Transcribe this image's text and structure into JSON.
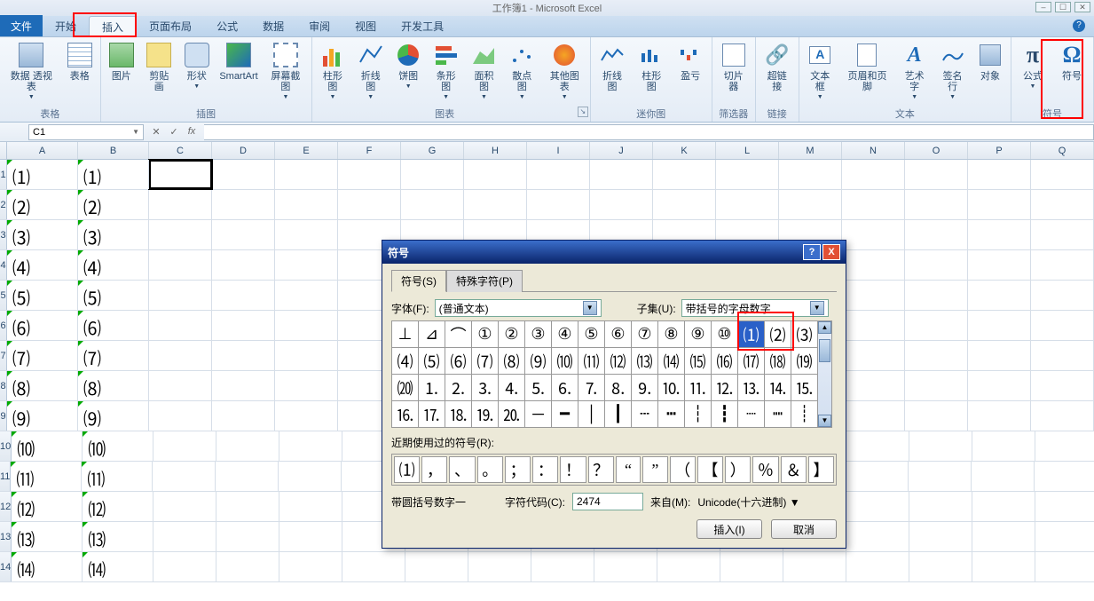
{
  "title": "工作簿1 - Microsoft Excel",
  "tabs": {
    "file": "文件",
    "list": [
      "开始",
      "插入",
      "页面布局",
      "公式",
      "数据",
      "审阅",
      "视图",
      "开发工具"
    ],
    "active_index": 1
  },
  "ribbon": {
    "groups": [
      {
        "label": "表格",
        "buttons": [
          {
            "name": "pivot",
            "label": "数据\n透视表",
            "icon": "pivot",
            "drop": true
          },
          {
            "name": "table",
            "label": "表格",
            "icon": "table"
          }
        ]
      },
      {
        "label": "插图",
        "buttons": [
          {
            "name": "picture",
            "label": "图片",
            "icon": "pic"
          },
          {
            "name": "clipart",
            "label": "剪贴画",
            "icon": "clip"
          },
          {
            "name": "shapes",
            "label": "形状",
            "icon": "shape",
            "drop": true
          },
          {
            "name": "smartart",
            "label": "SmartArt",
            "icon": "smart"
          },
          {
            "name": "screenshot",
            "label": "屏幕截图",
            "icon": "shot",
            "drop": true
          }
        ]
      },
      {
        "label": "图表",
        "launcher": true,
        "buttons": [
          {
            "name": "column-chart",
            "label": "柱形图",
            "icon": "bar",
            "drop": true
          },
          {
            "name": "line-chart",
            "label": "折线图",
            "icon": "line",
            "drop": true
          },
          {
            "name": "pie-chart",
            "label": "饼图",
            "icon": "pie",
            "drop": true
          },
          {
            "name": "bar-chart",
            "label": "条形图",
            "icon": "hbar",
            "drop": true
          },
          {
            "name": "area-chart",
            "label": "面积图",
            "icon": "area",
            "drop": true
          },
          {
            "name": "scatter-chart",
            "label": "散点图",
            "icon": "scatter",
            "drop": true
          },
          {
            "name": "other-chart",
            "label": "其他图表",
            "icon": "other",
            "drop": true
          }
        ]
      },
      {
        "label": "迷你图",
        "buttons": [
          {
            "name": "sparkline",
            "label": "折线图",
            "icon": "sline"
          },
          {
            "name": "sparkcol",
            "label": "柱形图",
            "icon": "scol"
          },
          {
            "name": "sparkwl",
            "label": "盈亏",
            "icon": "swl"
          }
        ]
      },
      {
        "label": "筛选器",
        "buttons": [
          {
            "name": "slicer",
            "label": "切片器",
            "icon": "slicer"
          }
        ]
      },
      {
        "label": "链接",
        "buttons": [
          {
            "name": "hyperlink",
            "label": "超链接",
            "icon": "link"
          }
        ]
      },
      {
        "label": "文本",
        "buttons": [
          {
            "name": "textbox",
            "label": "文本框",
            "icon": "tbox",
            "drop": true
          },
          {
            "name": "headerfooter",
            "label": "页眉和页脚",
            "icon": "hf"
          },
          {
            "name": "wordart",
            "label": "艺术字",
            "icon": "wa",
            "drop": true
          },
          {
            "name": "sigline",
            "label": "签名行",
            "icon": "sig",
            "drop": true
          },
          {
            "name": "object",
            "label": "对象",
            "icon": "obj"
          }
        ]
      },
      {
        "label": "符号",
        "buttons": [
          {
            "name": "equation",
            "label": "公式",
            "icon": "pi",
            "drop": true
          },
          {
            "name": "symbol",
            "label": "符号",
            "icon": "omega"
          }
        ]
      }
    ]
  },
  "namebox": "C1",
  "fbar_fx": "fx",
  "columns": [
    "A",
    "B",
    "C",
    "D",
    "E",
    "F",
    "G",
    "H",
    "I",
    "J",
    "K",
    "L",
    "M",
    "N",
    "O",
    "P",
    "Q"
  ],
  "cells": {
    "A": [
      "⑴",
      "⑵",
      "⑶",
      "⑷",
      "⑸",
      "⑹",
      "⑺",
      "⑻",
      "⑼",
      "⑽",
      "⑾",
      "⑿",
      "⒀",
      "⒁"
    ],
    "B": [
      "⑴",
      "⑵",
      "⑶",
      "⑷",
      "⑸",
      "⑹",
      "⑺",
      "⑻",
      "⑼",
      "⑽",
      "⑾",
      "⑿",
      "⒀",
      "⒁"
    ]
  },
  "selected_cell": "C1",
  "dialog": {
    "title": "符号",
    "tabs": [
      "符号(S)",
      "特殊字符(P)"
    ],
    "active_tab": 0,
    "font_label": "字体(F):",
    "font_value": "(普通文本)",
    "subset_label": "子集(U):",
    "subset_value": "带括号的字母数字",
    "grid": [
      [
        "⊥",
        "⊿",
        "⌒",
        "①",
        "②",
        "③",
        "④",
        "⑤",
        "⑥",
        "⑦",
        "⑧",
        "⑨",
        "⑩",
        "⑴",
        "⑵",
        "⑶"
      ],
      [
        "⑷",
        "⑸",
        "⑹",
        "⑺",
        "⑻",
        "⑼",
        "⑽",
        "⑾",
        "⑿",
        "⒀",
        "⒁",
        "⒂",
        "⒃",
        "⒄",
        "⒅",
        "⒆"
      ],
      [
        "⒇",
        "⒈",
        "⒉",
        "⒊",
        "⒋",
        "⒌",
        "⒍",
        "⒎",
        "⒏",
        "⒐",
        "⒑",
        "⒒",
        "⒓",
        "⒔",
        "⒕",
        "⒖"
      ],
      [
        "⒗",
        "⒘",
        "⒙",
        "⒚",
        "⒛",
        "─",
        "━",
        "│",
        "┃",
        "┄",
        "┅",
        "┆",
        "┇",
        "┈",
        "┉",
        "┊"
      ]
    ],
    "grid_selected": [
      0,
      13
    ],
    "recent_label": "近期使用过的符号(R):",
    "recent": [
      "⑴",
      "，",
      "、",
      "。",
      "；",
      "：",
      "！",
      "？",
      "“",
      "”",
      "（",
      "【",
      "）",
      "％",
      "＆",
      "】"
    ],
    "name_label": "带圆括号数字一",
    "code_label": "字符代码(C):",
    "code_value": "2474",
    "from_label": "来自(M):",
    "from_value": "Unicode(十六进制)",
    "insert_btn": "插入(I)",
    "cancel_btn": "取消"
  }
}
